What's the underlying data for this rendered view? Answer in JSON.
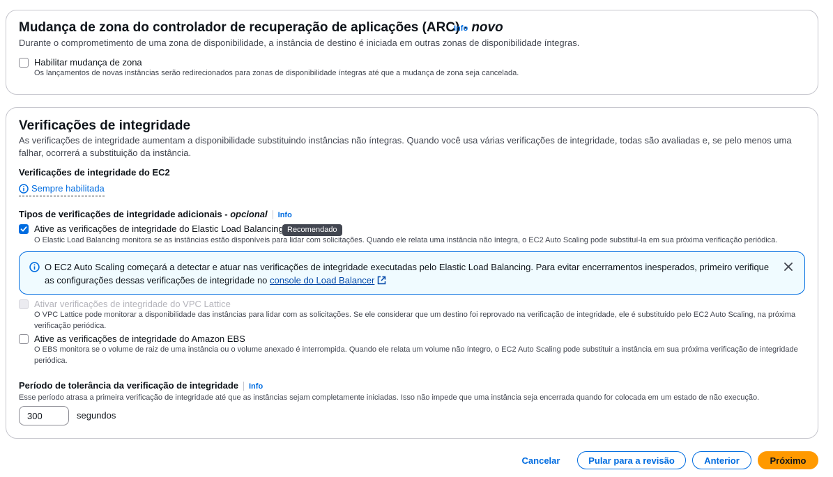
{
  "arc": {
    "title": "Mudança de zona do controlador de recuperação de aplicações (ARC) - ",
    "title_new": "novo",
    "info": "Info",
    "description": "Durante o comprometimento de uma zona de disponibilidade, a instância de destino é iniciada em outras zonas de disponibilidade íntegras.",
    "checkbox_label": "Habilitar mudança de zona",
    "checkbox_checked": false,
    "checkbox_desc": "Os lançamentos de novas instâncias serão redirecionados para zonas de disponibilidade íntegras até que a mudança de zona seja cancelada."
  },
  "health": {
    "title": "Verificações de integridade",
    "description": "As verificações de integridade aumentam a disponibilidade substituindo instâncias não íntegras. Quando você usa várias verificações de integridade, todas são avaliadas e, se pelo menos uma falhar, ocorrerá a substituição da instância.",
    "ec2_label": "Verificações de integridade do EC2",
    "ec2_status": "Sempre habilitada",
    "additional_label": "Tipos de verificações de integridade adicionais - ",
    "additional_optional": "opcional",
    "info": "Info",
    "elb": {
      "label": "Ative as verificações de integridade do Elastic Load Balancing",
      "badge": "Recomendado",
      "checked": true,
      "desc": "O Elastic Load Balancing monitora se as instâncias estão disponíveis para lidar com solicitações. Quando ele relata uma instância não íntegra, o EC2 Auto Scaling pode substituí-la em sua próxima verificação periódica."
    },
    "alert": {
      "text": "O EC2 Auto Scaling começará a detectar e atuar nas verificações de integridade executadas pelo Elastic Load Balancing. Para evitar encerramentos inesperados, primeiro verifique as configurações dessas verificações de integridade no ",
      "link": "console do Load Balancer"
    },
    "vpc": {
      "label": "Ativar verificações de integridade do VPC Lattice",
      "disabled": true,
      "desc": "O VPC Lattice pode monitorar a disponibilidade das instâncias para lidar com as solicitações. Se ele considerar que um destino foi reprovado na verificação de integridade, ele é substituído pelo EC2 Auto Scaling, na próxima verificação periódica."
    },
    "ebs": {
      "label": "Ative as verificações de integridade do Amazon EBS",
      "checked": false,
      "desc": "O EBS monitora se o volume de raiz de uma instância ou o volume anexado é interrompida. Quando ele relata um volume não íntegro, o EC2 Auto Scaling pode substituir a instância em sua próxima verificação de integridade periódica."
    },
    "grace_label": "Período de tolerância da verificação de integridade",
    "grace_info": "Info",
    "grace_desc": "Esse período atrasa a primeira verificação de integridade até que as instâncias sejam completamente iniciadas. Isso não impede que uma instância seja encerrada quando for colocada em um estado de não execução.",
    "grace_value": "300",
    "grace_unit": "segundos"
  },
  "footer": {
    "cancel": "Cancelar",
    "skip": "Pular para a revisão",
    "previous": "Anterior",
    "next": "Próximo"
  },
  "colors": {
    "primary_button": "#ff9900",
    "link": "#006ce0",
    "alert_bg": "#f0fbff"
  }
}
